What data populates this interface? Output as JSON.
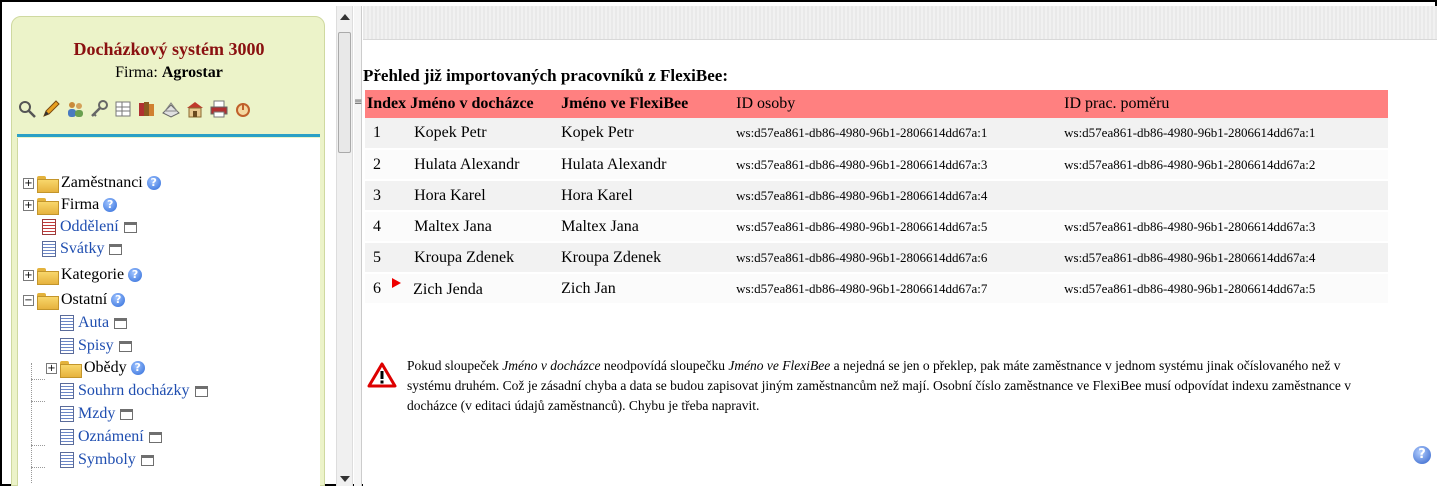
{
  "sidebar": {
    "app_title": "Docházkový systém 3000",
    "company_label": "Firma:",
    "company_name": "Agrostar",
    "toolbar_icons": [
      "search-icon",
      "pencil-icon",
      "users-icon",
      "key-icon",
      "table-icon",
      "books-icon",
      "printer-stack-icon",
      "building-icon",
      "print-icon",
      "power-icon"
    ],
    "tree": [
      {
        "label": "Zaměstnanci",
        "kind": "folder",
        "expander": "+",
        "help": true
      },
      {
        "label": "Firma",
        "kind": "folder",
        "expander": "+",
        "help": true
      },
      {
        "label": "Oddělení",
        "kind": "doc-red",
        "link": true,
        "window": true
      },
      {
        "label": "Svátky",
        "kind": "doc",
        "link": true,
        "window": true
      },
      {
        "label": "Kategorie",
        "kind": "folder",
        "expander": "+",
        "help": true
      },
      {
        "label": "Ostatní",
        "kind": "folder",
        "expander": "−",
        "help": true
      },
      {
        "label": "Auta",
        "kind": "doc",
        "link": true,
        "window": true
      },
      {
        "label": "Spisy",
        "kind": "doc",
        "link": true,
        "window": true
      },
      {
        "label": "Obědy",
        "kind": "folder",
        "expander": "+",
        "help": true
      },
      {
        "label": "Souhrn docházky",
        "kind": "doc",
        "link": true,
        "window": true
      },
      {
        "label": "Mzdy",
        "kind": "doc",
        "link": true,
        "window": true
      },
      {
        "label": "Oznámení",
        "kind": "doc",
        "link": true,
        "window": true
      },
      {
        "label": "Symboly",
        "kind": "doc",
        "link": true,
        "window": true
      }
    ]
  },
  "main": {
    "section_title": "Přehled již importovaných pracovníků z FlexiBee:",
    "columns": [
      "Index",
      "Jméno v docházce",
      "Jméno ve FlexiBee",
      "ID osoby",
      "ID prac. poměru"
    ],
    "rows": [
      {
        "index": "1",
        "flag": false,
        "name_attendance": "Kopek Petr",
        "name_flexibee": "Kopek Petr",
        "person_id": "ws:d57ea861-db86-4980-96b1-2806614dd67a:1",
        "contract_id": "ws:d57ea861-db86-4980-96b1-2806614dd67a:1"
      },
      {
        "index": "2",
        "flag": false,
        "name_attendance": "Hulata Alexandr",
        "name_flexibee": "Hulata Alexandr",
        "person_id": "ws:d57ea861-db86-4980-96b1-2806614dd67a:3",
        "contract_id": "ws:d57ea861-db86-4980-96b1-2806614dd67a:2"
      },
      {
        "index": "3",
        "flag": false,
        "name_attendance": "Hora Karel",
        "name_flexibee": "Hora Karel",
        "person_id": "ws:d57ea861-db86-4980-96b1-2806614dd67a:4",
        "contract_id": ""
      },
      {
        "index": "4",
        "flag": false,
        "name_attendance": "Maltex Jana",
        "name_flexibee": "Maltex Jana",
        "person_id": "ws:d57ea861-db86-4980-96b1-2806614dd67a:5",
        "contract_id": "ws:d57ea861-db86-4980-96b1-2806614dd67a:3"
      },
      {
        "index": "5",
        "flag": false,
        "name_attendance": "Kroupa Zdenek",
        "name_flexibee": "Kroupa Zdenek",
        "person_id": "ws:d57ea861-db86-4980-96b1-2806614dd67a:6",
        "contract_id": "ws:d57ea861-db86-4980-96b1-2806614dd67a:4"
      },
      {
        "index": "6",
        "flag": true,
        "name_attendance": "Zich Jenda",
        "name_flexibee": "Zich Jan",
        "person_id": "ws:d57ea861-db86-4980-96b1-2806614dd67a:7",
        "contract_id": "ws:d57ea861-db86-4980-96b1-2806614dd67a:5"
      }
    ],
    "warning": {
      "part1": "Pokud sloupeček ",
      "col1": "Jméno v docházce",
      "part2": " neodpovídá sloupečku ",
      "col2": "Jméno ve FlexiBee",
      "part3": " a nejedná se jen o překlep, pak máte zaměstnance v jednom systému jinak očíslovaného než v systému druhém. Což je zásadní chyba a data se budou zapisovat jiným zaměstnancům než mají. Osobní číslo zaměstnance ve FlexiBee musí odpovídat indexu zaměstnance v docházce (v editaci údajů zaměstnanců). Chybu je třeba napravit."
    }
  },
  "colors": {
    "header_bg": "#ff8080",
    "title_red": "#8a1010",
    "panel_bg": "#ecf3c9",
    "accent_line": "#2ba0c6"
  }
}
